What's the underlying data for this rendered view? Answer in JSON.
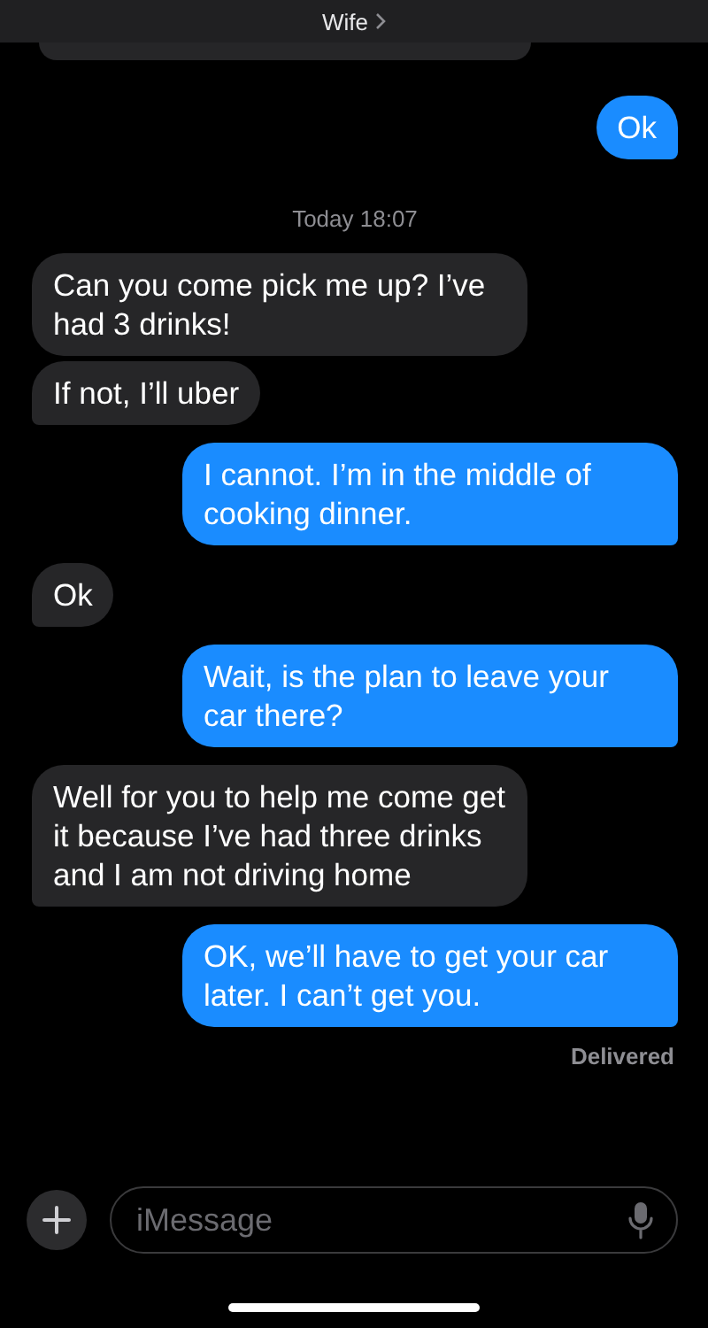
{
  "header": {
    "title": "Wife"
  },
  "thread": [
    {
      "kind": "sent",
      "text": "Ok"
    },
    {
      "kind": "timestamp",
      "text": "Today 18:07"
    },
    {
      "kind": "received",
      "text": "Can you come pick me up? I’ve had 3 drinks!"
    },
    {
      "kind": "received",
      "text": "If not, I’ll uber"
    },
    {
      "kind": "sent",
      "text": "I cannot. I’m in the middle of cooking dinner."
    },
    {
      "kind": "received",
      "text": "Ok"
    },
    {
      "kind": "sent",
      "text": "Wait, is the plan to leave your car there?"
    },
    {
      "kind": "received",
      "text": "Well for you to help me come get it because I’ve had three drinks and I am not driving home"
    },
    {
      "kind": "sent",
      "text": "OK, we’ll have to get your car later. I can’t get you."
    },
    {
      "kind": "status",
      "text": "Delivered"
    }
  ],
  "composer": {
    "placeholder": "iMessage"
  }
}
